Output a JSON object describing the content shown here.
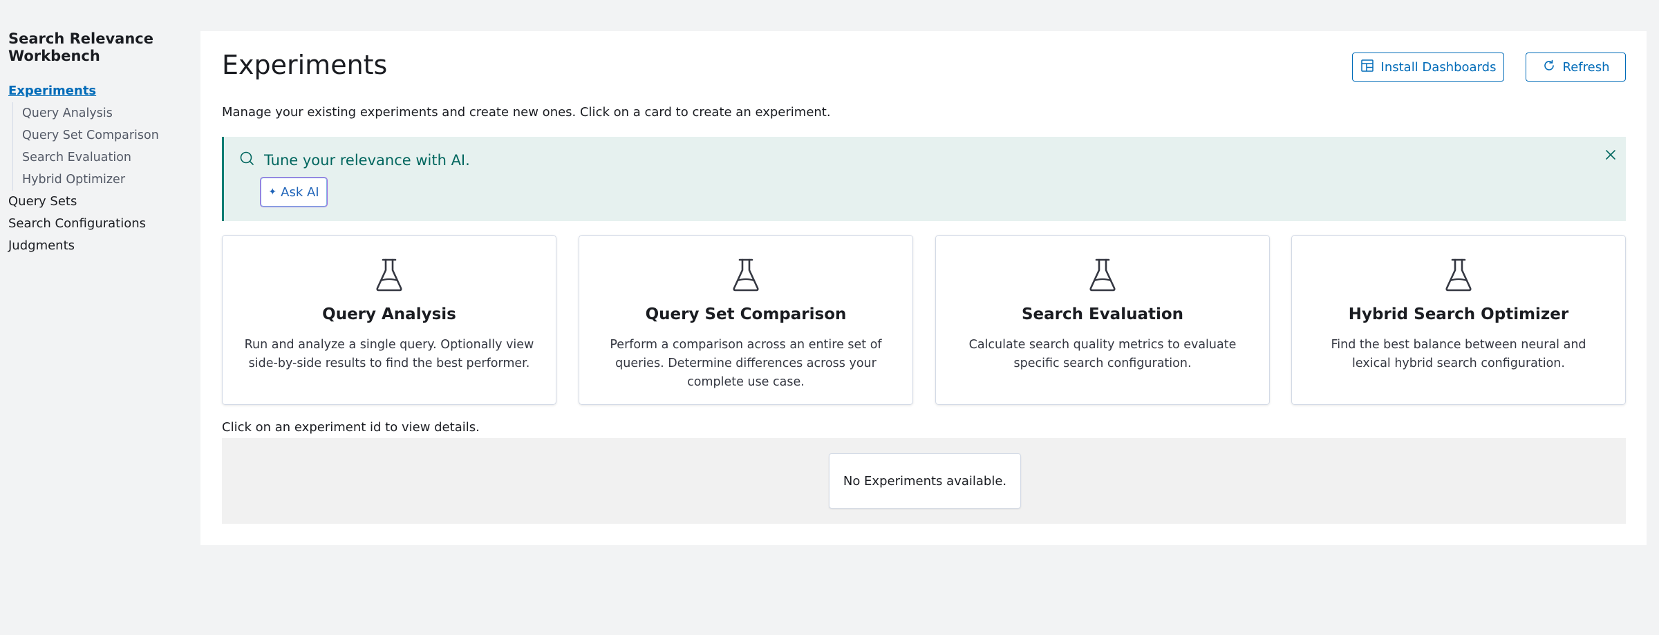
{
  "sidebar": {
    "app_title": "Search Relevance Workbench",
    "experiments_label": "Experiments",
    "sub_items": [
      "Query Analysis",
      "Query Set Comparison",
      "Search Evaluation",
      "Hybrid Optimizer"
    ],
    "items": [
      "Query Sets",
      "Search Configurations",
      "Judgments"
    ]
  },
  "header": {
    "title": "Experiments",
    "install_label": "Install Dashboards",
    "refresh_label": "Refresh"
  },
  "description": "Manage your existing experiments and create new ones. Click on a card to create an experiment.",
  "callout": {
    "title": "Tune your relevance with AI.",
    "ask_label": "Ask AI"
  },
  "cards": [
    {
      "title": "Query Analysis",
      "desc": "Run and analyze a single query. Optionally view side-by-side results to find the best performer."
    },
    {
      "title": "Query Set Comparison",
      "desc": "Perform a comparison across an entire set of queries. Determine differences across your complete use case."
    },
    {
      "title": "Search Evaluation",
      "desc": "Calculate search quality metrics to evaluate specific search configuration."
    },
    {
      "title": "Hybrid Search Optimizer",
      "desc": "Find the best balance between neural and lexical hybrid search configuration."
    }
  ],
  "hint": "Click on an experiment id to view details.",
  "empty_message": "No Experiments available.",
  "icons": {
    "install": "dashboard-icon",
    "refresh": "refresh-icon",
    "callout": "search-icon",
    "ask": "sparkle-icon",
    "close": "close-icon",
    "card": "beaker-icon"
  },
  "colors": {
    "accent": "#006bb8",
    "callout_bg": "#e6f1ef",
    "callout_text": "#00665e",
    "page_bg": "#f2f3f4"
  }
}
